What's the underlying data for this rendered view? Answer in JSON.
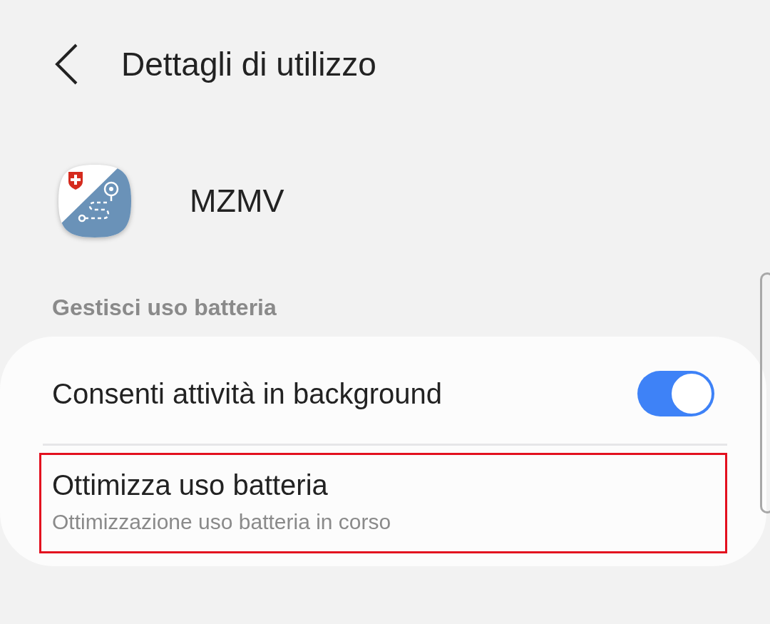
{
  "header": {
    "title": "Dettagli di utilizzo"
  },
  "app": {
    "name": "MZMV"
  },
  "section": {
    "title": "Gestisci uso batteria"
  },
  "items": [
    {
      "kind": "toggle",
      "label": "Consenti attività in background",
      "on": true,
      "highlighted": false
    },
    {
      "kind": "text",
      "label": "Ottimizza uso batteria",
      "subtitle": "Ottimizzazione uso batteria in corso",
      "highlighted": true
    }
  ]
}
